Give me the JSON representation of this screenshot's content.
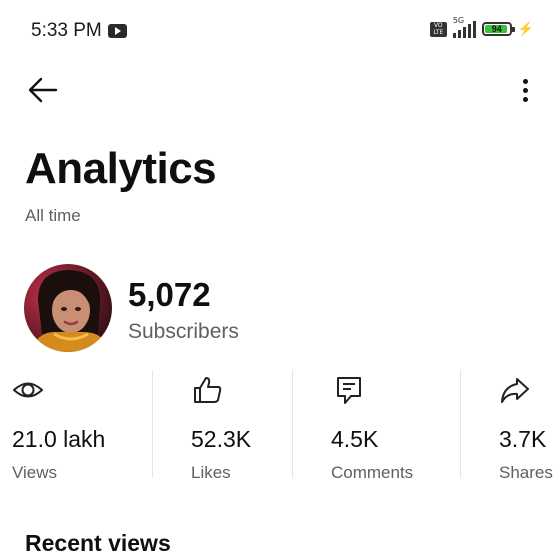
{
  "status_bar": {
    "time": "5:33 PM",
    "network": "5G",
    "battery": "94",
    "battery_level": 0.94,
    "battery_color": "#39c239",
    "icons": [
      "youtube-notification-icon",
      "volte-icon",
      "signal-icon",
      "battery-icon",
      "charging-icon"
    ]
  },
  "header": {
    "back_icon": "arrow-left-icon",
    "menu_icon": "more-vertical-icon"
  },
  "page": {
    "title": "Analytics",
    "subtitle": "All time"
  },
  "channel": {
    "subscribers_value": "5,072",
    "subscribers_label": "Subscribers"
  },
  "stats": [
    {
      "icon": "eye-icon",
      "value": "21.0 lakh",
      "label": "Views"
    },
    {
      "icon": "thumbs-up-icon",
      "value": "52.3K",
      "label": "Likes"
    },
    {
      "icon": "comment-icon",
      "value": "4.5K",
      "label": "Comments"
    },
    {
      "icon": "share-icon",
      "value": "3.7K",
      "label": "Shares"
    }
  ],
  "sections": {
    "recent_views_title": "Recent views"
  }
}
